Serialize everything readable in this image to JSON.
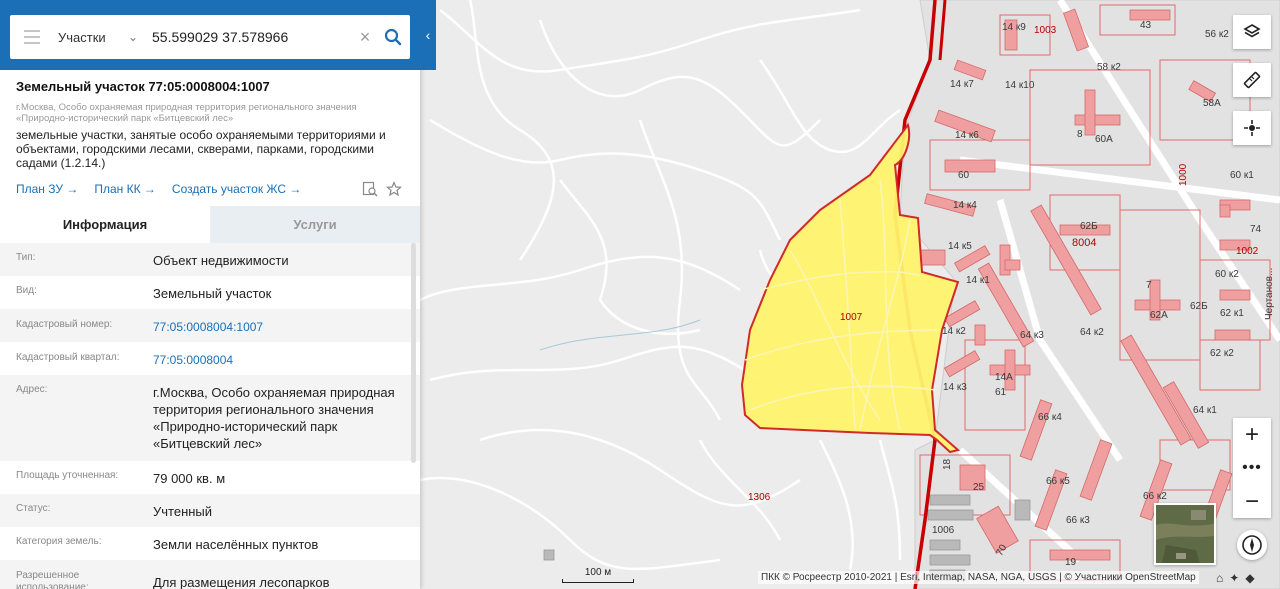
{
  "search": {
    "type_label": "Участки",
    "query": "55.599029 37.578966"
  },
  "plot": {
    "title": "Земельный участок 77:05:0008004:1007",
    "location": "г.Москва, Особо охраняемая природная территория регионального значения «Природно-исторический парк «Битцевский лес»",
    "usage": "земельные участки, занятые особо охраняемыми территориями и объектами, городскими лесами, скверами, парками, городскими садами (1.2.14.)",
    "links": [
      "План ЗУ →",
      "План КК →",
      "Создать участок ЖС →"
    ]
  },
  "tabs": [
    "Информация",
    "Услуги"
  ],
  "info": [
    {
      "key": "Тип:",
      "value": "Объект недвижимости",
      "link": false
    },
    {
      "key": "Вид:",
      "value": "Земельный участок",
      "link": false
    },
    {
      "key": "Кадастровый номер:",
      "value": "77:05:0008004:1007",
      "link": true
    },
    {
      "key": "Кадастровый квартал:",
      "value": "77:05:0008004",
      "link": true
    },
    {
      "key": "Адрес:",
      "value": "г.Москва, Особо охраняемая природная территория регионального значения «Природно-исторический парк «Битцевский лес»",
      "link": false
    },
    {
      "key": "Площадь уточненная:",
      "value": "79 000 кв. м",
      "link": false
    },
    {
      "key": "Статус:",
      "value": "Учтенный",
      "link": false
    },
    {
      "key": "Категория земель:",
      "value": "Земли населённых пунктов",
      "link": false
    },
    {
      "key": "Разрешенное использование:",
      "value": "Для размещения лесопарков",
      "link": false
    }
  ],
  "map": {
    "selected_plot_label": "1007",
    "plot_labels": [
      "1003",
      "43",
      "56 к2",
      "14 к9",
      "58 к2",
      "14 к7",
      "14 к10",
      "8",
      "60А",
      "58А",
      "14 к6",
      "60",
      "1000",
      "60 к1",
      "14 к4",
      "62Б",
      "8004",
      "74",
      "1002",
      "14 к5",
      "7",
      "60 к2",
      "62Б",
      "14 к1",
      "62А",
      "62 к1",
      "64 к3",
      "64 к2",
      "14 к2",
      "62 к2",
      "14А",
      "61",
      "14 к3",
      "64 к1",
      "66 к4",
      "18",
      "25",
      "66 к5",
      "66 к2",
      "1306",
      "1006",
      "66 к3",
      "70",
      "19",
      "Чертанов..."
    ],
    "scale_label": "100 м",
    "attribution": "ПКК © Росреестр 2010-2021 | Esri, Intermap, NASA, NGA, USGS | © Участники OpenStreetMap",
    "zoom_in": "+",
    "zoom_more": "•••",
    "zoom_out": "−"
  },
  "colors": {
    "accent": "#1a6fb7",
    "plot_fill": "#fff36b",
    "plot_border": "#c81e1e",
    "boundary": "#c80000"
  }
}
